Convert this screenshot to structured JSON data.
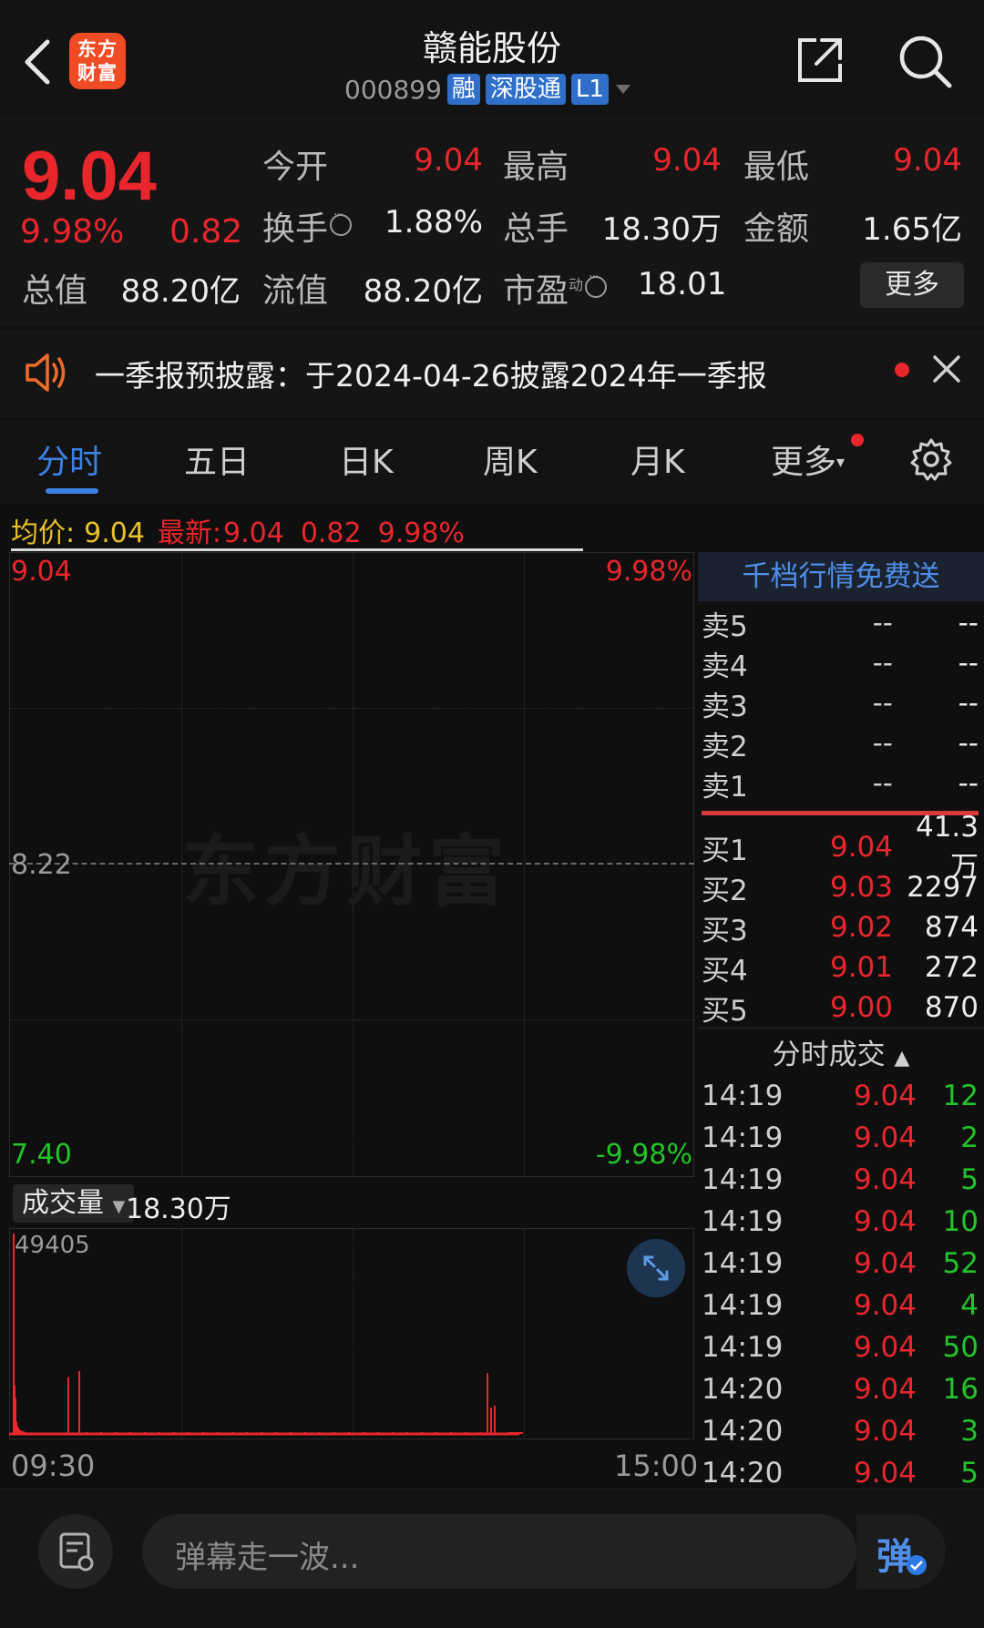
{
  "header": {
    "logo_text_line1": "东方",
    "logo_text_line2": "财富",
    "stock_name": "赣能股份",
    "stock_code": "000899",
    "tags": [
      "融",
      "深股通",
      "L1"
    ]
  },
  "quote": {
    "price": "9.04",
    "change_pct": "9.98%",
    "change_val": "0.82",
    "open_label": "今开",
    "open": "9.04",
    "high_label": "最高",
    "high": "9.04",
    "low_label": "最低",
    "low": "9.04",
    "turnover_label": "换手",
    "turnover": "1.88%",
    "volume_label": "总手",
    "volume": "18.30万",
    "amount_label": "金额",
    "amount": "1.65亿",
    "mcap_label": "总值",
    "mcap": "88.20亿",
    "float_label": "流值",
    "float_cap": "88.20亿",
    "pe_label": "市盈",
    "pe_sup": "动",
    "pe": "18.01",
    "more_label": "更多"
  },
  "notice": {
    "text": "一季报预披露：于2024-04-26披露2024年一季报"
  },
  "tabs": [
    "分时",
    "五日",
    "日K",
    "周K",
    "月K",
    "更多"
  ],
  "chart_info": {
    "avg_label": "均价:",
    "avg": "9.04",
    "latest_label": "最新:",
    "latest": "9.04",
    "change": "0.82",
    "pct": "9.98%"
  },
  "chart_axis": {
    "top_price": "9.04",
    "top_pct": "9.98%",
    "mid_price": "8.22",
    "bottom_price": "7.40",
    "bottom_pct": "-9.98%",
    "watermark": "东方财富",
    "time_start": "09:30",
    "time_end": "15:00"
  },
  "volume_panel": {
    "label": "成交量",
    "total": "18.30万",
    "max": "49405"
  },
  "chart_data": {
    "type": "bar",
    "title": "",
    "ylabel": "成交量",
    "x_range": [
      "09:30",
      "15:00"
    ],
    "ylim": [
      0,
      49405
    ],
    "values": [
      49405,
      12000,
      9000,
      3000,
      2000,
      1500,
      1200,
      900,
      800,
      700,
      600,
      14000,
      600,
      500,
      15500,
      500,
      400,
      400,
      300,
      300,
      350,
      300,
      300,
      280,
      300,
      260,
      250,
      240,
      230,
      220,
      210,
      200,
      200,
      190,
      180,
      170,
      160,
      150,
      140,
      130,
      120,
      110,
      100,
      90,
      90,
      15000,
      6500,
      7000,
      300,
      250,
      220,
      200,
      180,
      160,
      150,
      140
    ],
    "colors": {
      "bar": "#e8262c"
    }
  },
  "order_book": {
    "banner": "千档行情免费送",
    "asks": [
      {
        "label": "卖5",
        "price": "--",
        "vol": "--"
      },
      {
        "label": "卖4",
        "price": "--",
        "vol": "--"
      },
      {
        "label": "卖3",
        "price": "--",
        "vol": "--"
      },
      {
        "label": "卖2",
        "price": "--",
        "vol": "--"
      },
      {
        "label": "卖1",
        "price": "--",
        "vol": "--"
      }
    ],
    "bids": [
      {
        "label": "买1",
        "price": "9.04",
        "vol": "41.3万"
      },
      {
        "label": "买2",
        "price": "9.03",
        "vol": "2297"
      },
      {
        "label": "买3",
        "price": "9.02",
        "vol": "874"
      },
      {
        "label": "买4",
        "price": "9.01",
        "vol": "272"
      },
      {
        "label": "买5",
        "price": "9.00",
        "vol": "870"
      }
    ]
  },
  "trades": {
    "title": "分时成交",
    "rows": [
      {
        "time": "14:19",
        "price": "9.04",
        "vol": "12"
      },
      {
        "time": "14:19",
        "price": "9.04",
        "vol": "2"
      },
      {
        "time": "14:19",
        "price": "9.04",
        "vol": "5"
      },
      {
        "time": "14:19",
        "price": "9.04",
        "vol": "10"
      },
      {
        "time": "14:19",
        "price": "9.04",
        "vol": "52"
      },
      {
        "time": "14:19",
        "price": "9.04",
        "vol": "4"
      },
      {
        "time": "14:19",
        "price": "9.04",
        "vol": "50"
      },
      {
        "time": "14:20",
        "price": "9.04",
        "vol": "16"
      },
      {
        "time": "14:20",
        "price": "9.04",
        "vol": "3"
      },
      {
        "time": "14:20",
        "price": "9.04",
        "vol": "5"
      }
    ]
  },
  "bottom": {
    "placeholder": "弹幕走一波...",
    "send_label": "弹"
  },
  "colors": {
    "up": "#e8262c",
    "down": "#22c42a",
    "accent": "#3c82e6",
    "background": "#0f0f0f"
  }
}
